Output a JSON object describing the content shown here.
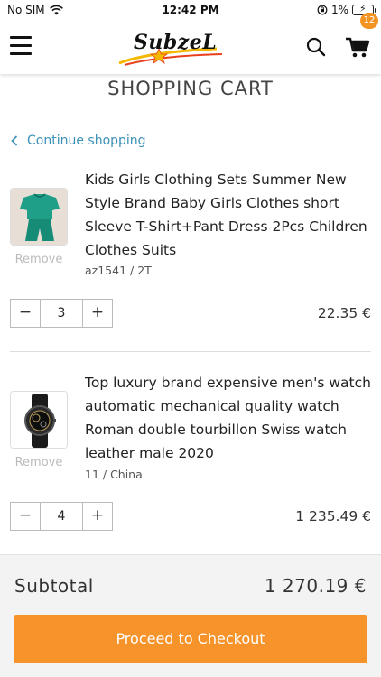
{
  "status_bar": {
    "carrier": "No SIM",
    "time": "12:42 PM",
    "battery": "1%"
  },
  "header": {
    "logo_text": "SubzeL",
    "cart_count": "12"
  },
  "page": {
    "title": "SHOPPING CART",
    "continue_label": "Continue shopping"
  },
  "items": [
    {
      "title": "Kids Girls Clothing Sets Summer New Style Brand Baby Girls Clothes short Sleeve T-Shirt+Pant Dress 2Pcs Children Clothes Suits",
      "variant": "az1541 / 2T",
      "remove_label": "Remove",
      "quantity": "3",
      "price": "22.35 €",
      "image_icon": "green-clothing-set-image"
    },
    {
      "title": "Top luxury brand expensive men's watch automatic mechanical quality watch Roman double tourbillon Swiss watch leather male 2020",
      "variant": "11 / China",
      "remove_label": "Remove",
      "quantity": "4",
      "price": "1 235.49 €",
      "image_icon": "black-watch-image"
    }
  ],
  "footer": {
    "subtotal_label": "Subtotal",
    "subtotal_value": "1 270.19 €",
    "checkout_label": "Proceed to Checkout"
  },
  "colors": {
    "accent": "#f6932a",
    "link": "#3b8fb8",
    "badge": "#f39422"
  }
}
